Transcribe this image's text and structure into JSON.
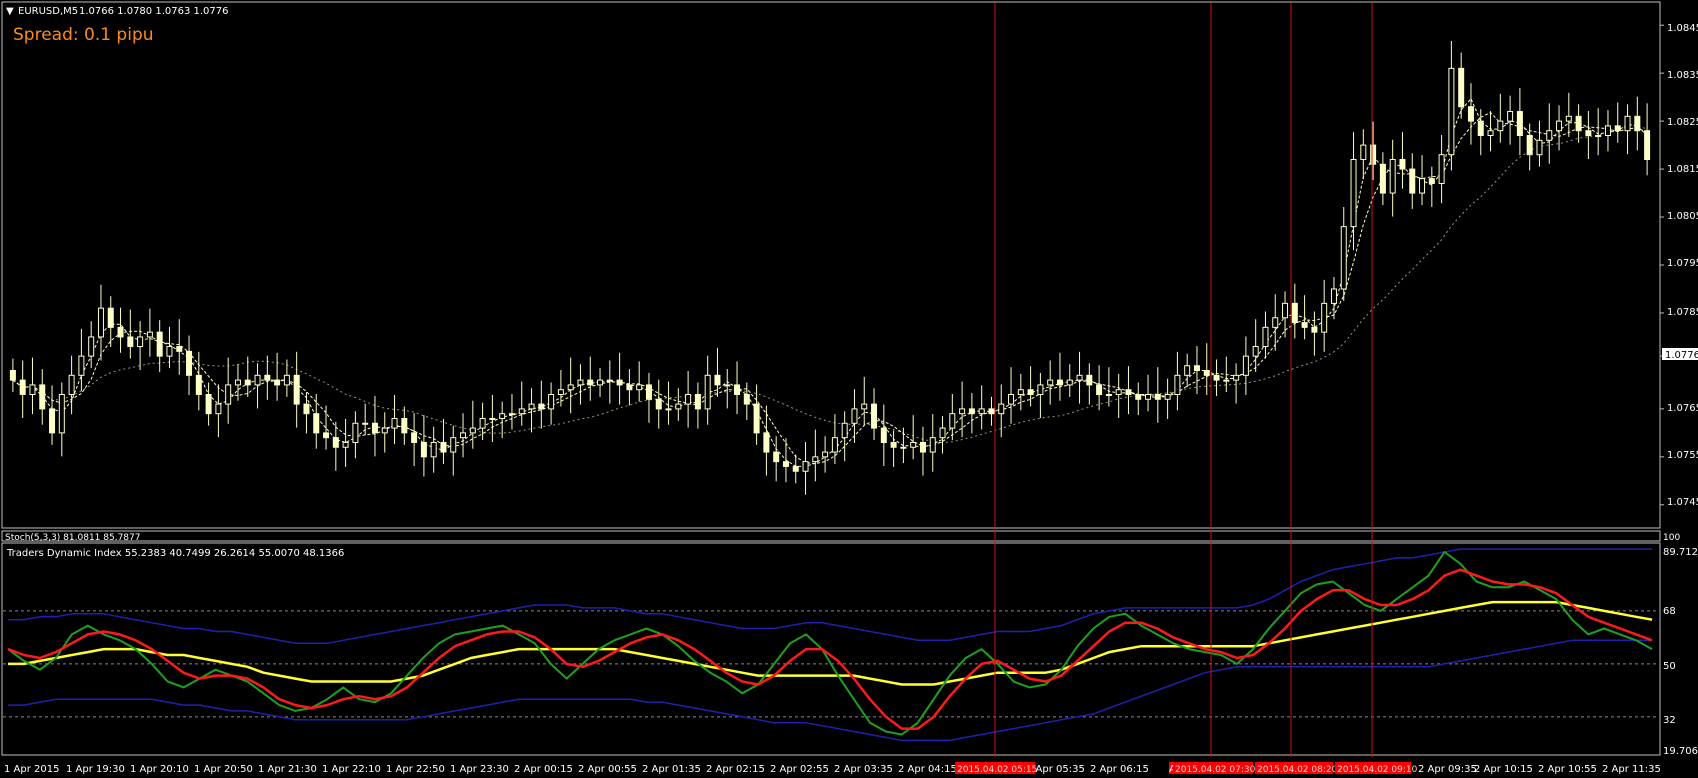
{
  "header": {
    "symbol": "EURUSD,M5",
    "ohlc": "1.0766 1.0780 1.0763 1.0776",
    "spread_text": "Spread: 0.1 pipu"
  },
  "colors": {
    "background": "#000000",
    "frame": "#c0c0c0",
    "candle": "#ffffc8",
    "ma": "#ffffc8",
    "vline": "#d01010",
    "tdi_green": "#1fa01f",
    "tdi_red": "#ff1a1a",
    "tdi_yellow": "#ffff33",
    "tdi_band": "#2020b0",
    "spread": "#ff8c1a",
    "time_badge": "#ff0000"
  },
  "price_axis": {
    "labels": [
      "1.0845",
      "1.0835",
      "1.0825",
      "1.0815",
      "1.0805",
      "1.0795",
      "1.0785",
      "1.0776",
      "1.0765",
      "1.0755",
      "1.0745"
    ],
    "current": "1.0776"
  },
  "stoch_panel": {
    "label": "Stoch(5,3,3) 81.0811 85.7877",
    "axis_value": "100"
  },
  "tdi_panel": {
    "label": "Traders Dynamic Index 55.2383 40.7499 26.2614 55.0070 48.1366",
    "axis_labels": [
      "89.7123",
      "68",
      "50",
      "32",
      "19.7063"
    ]
  },
  "time_axis": {
    "labels": [
      "1 Apr 2015",
      "1 Apr 19:30",
      "1 Apr 20:10",
      "1 Apr 20:50",
      "1 Apr 21:30",
      "1 Apr 22:10",
      "1 Apr 22:50",
      "1 Apr 23:30",
      "2 Apr 00:15",
      "2 Apr 00:55",
      "2 Apr 01:35",
      "2 Apr 02:15",
      "2 Apr 02:55",
      "2 Apr 03:35",
      "2 Apr 04:15",
      "2 Apr 05:35",
      "2 Apr 06:15",
      "2 Apr 09:35",
      "2 Apr 10:15",
      "2 Apr 10:55",
      "2 Apr 11:35"
    ],
    "badges": [
      "2015.04.02 05:15",
      "2015.04.02 07:30",
      "2015.04.02 08:20",
      "2015.04.02 09:10"
    ],
    "badge_prefix": "Ap"
  },
  "chart_data": {
    "type": "candlestick",
    "price_range": [
      1.0741,
      1.0849
    ],
    "closes": [
      1.0771,
      1.0768,
      1.077,
      1.0765,
      1.076,
      1.0768,
      1.0772,
      1.0776,
      1.078,
      1.0786,
      1.0782,
      1.078,
      1.0778,
      1.078,
      1.0781,
      1.0776,
      1.0778,
      1.0777,
      1.0772,
      1.0768,
      1.0764,
      1.0766,
      1.077,
      1.0771,
      1.077,
      1.0772,
      1.0771,
      1.077,
      1.0772,
      1.0766,
      1.0764,
      1.076,
      1.0759,
      1.0757,
      1.0758,
      1.0762,
      1.0762,
      1.076,
      1.0761,
      1.0763,
      1.076,
      1.0758,
      1.0755,
      1.0758,
      1.0756,
      1.0759,
      1.076,
      1.0761,
      1.0763,
      1.0763,
      1.0764,
      1.0764,
      1.0765,
      1.0766,
      1.0765,
      1.0768,
      1.0769,
      1.077,
      1.0771,
      1.077,
      1.0771,
      1.0771,
      1.077,
      1.0769,
      1.077,
      1.0767,
      1.0765,
      1.0765,
      1.0766,
      1.0768,
      1.0765,
      1.0772,
      1.077,
      1.077,
      1.0768,
      1.0766,
      1.076,
      1.0756,
      1.0754,
      1.0753,
      1.0752,
      1.0754,
      1.0755,
      1.0756,
      1.0759,
      1.0762,
      1.0765,
      1.0766,
      1.0761,
      1.0758,
      1.0757,
      1.0757,
      1.0758,
      1.0756,
      1.0759,
      1.0761,
      1.0764,
      1.0765,
      1.0764,
      1.0765,
      1.0764,
      1.0766,
      1.0768,
      1.0769,
      1.0768,
      1.077,
      1.0771,
      1.077,
      1.0771,
      1.0772,
      1.077,
      1.0768,
      1.0768,
      1.0769,
      1.0768,
      1.0767,
      1.0768,
      1.0767,
      1.0768,
      1.0772,
      1.0774,
      1.0773,
      1.0772,
      1.0771,
      1.0771,
      1.0772,
      1.0776,
      1.0778,
      1.0782,
      1.0784,
      1.0787,
      1.0783,
      1.0782,
      1.0781,
      1.0787,
      1.079,
      1.0803,
      1.0817,
      1.082,
      1.0816,
      1.081,
      1.0817,
      1.0815,
      1.081,
      1.0813,
      1.0812,
      1.0818,
      1.0836,
      1.0828,
      1.0825,
      1.0822,
      1.0823,
      1.0825,
      1.0827,
      1.0822,
      1.0818,
      1.0821,
      1.0823,
      1.0825,
      1.0826,
      1.0823,
      1.0822,
      1.0822,
      1.0824,
      1.0823,
      1.0826,
      1.0823,
      1.0817
    ],
    "opens": [
      1.0773,
      1.0771,
      1.0768,
      1.077,
      1.0765,
      1.076,
      1.0768,
      1.0772,
      1.0776,
      1.078,
      1.0786,
      1.0782,
      1.078,
      1.0778,
      1.078,
      1.0781,
      1.0776,
      1.0778,
      1.0777,
      1.0772,
      1.0768,
      1.0764,
      1.0766,
      1.077,
      1.0771,
      1.077,
      1.0772,
      1.0771,
      1.077,
      1.0772,
      1.0766,
      1.0764,
      1.076,
      1.0759,
      1.0757,
      1.0758,
      1.0762,
      1.0762,
      1.076,
      1.0761,
      1.0763,
      1.076,
      1.0758,
      1.0755,
      1.0758,
      1.0756,
      1.0759,
      1.076,
      1.0761,
      1.0763,
      1.0763,
      1.0764,
      1.0764,
      1.0765,
      1.0766,
      1.0765,
      1.0768,
      1.0769,
      1.077,
      1.0771,
      1.077,
      1.0771,
      1.0771,
      1.077,
      1.0769,
      1.077,
      1.0767,
      1.0765,
      1.0765,
      1.0766,
      1.0768,
      1.0765,
      1.0772,
      1.077,
      1.077,
      1.0768,
      1.0766,
      1.076,
      1.0756,
      1.0754,
      1.0753,
      1.0752,
      1.0754,
      1.0755,
      1.0756,
      1.0759,
      1.0762,
      1.0765,
      1.0766,
      1.0761,
      1.0758,
      1.0757,
      1.0757,
      1.0758,
      1.0756,
      1.0759,
      1.0761,
      1.0764,
      1.0765,
      1.0764,
      1.0765,
      1.0764,
      1.0766,
      1.0768,
      1.0769,
      1.0768,
      1.077,
      1.0771,
      1.077,
      1.0771,
      1.0772,
      1.077,
      1.0768,
      1.0768,
      1.0769,
      1.0768,
      1.0767,
      1.0768,
      1.0767,
      1.0768,
      1.0772,
      1.0774,
      1.0773,
      1.0772,
      1.0771,
      1.0771,
      1.0772,
      1.0776,
      1.0778,
      1.0782,
      1.0784,
      1.0787,
      1.0783,
      1.0782,
      1.0781,
      1.0787,
      1.079,
      1.0803,
      1.0817,
      1.082,
      1.0816,
      1.081,
      1.0817,
      1.0815,
      1.081,
      1.0813,
      1.0812,
      1.0818,
      1.0836,
      1.0828,
      1.0825,
      1.0822,
      1.0823,
      1.0825,
      1.0827,
      1.0822,
      1.0818,
      1.0821,
      1.0823,
      1.0825,
      1.0826,
      1.0823,
      1.0822,
      1.0822,
      1.0824,
      1.0823,
      1.0826,
      1.0823
    ],
    "tdi": {
      "range": [
        19.7063,
        89.7123
      ],
      "green": [
        55,
        51,
        48,
        52,
        60,
        63,
        60,
        58,
        55,
        50,
        44,
        42,
        45,
        48,
        46,
        44,
        40,
        36,
        34,
        35,
        38,
        42,
        38,
        37,
        40,
        46,
        52,
        57,
        60,
        61,
        62,
        63,
        60,
        57,
        50,
        45,
        50,
        55,
        58,
        60,
        62,
        60,
        56,
        51,
        47,
        44,
        40,
        43,
        50,
        57,
        60,
        55,
        46,
        38,
        30,
        27,
        26,
        30,
        38,
        46,
        52,
        55,
        50,
        44,
        42,
        43,
        48,
        56,
        62,
        66,
        67,
        63,
        60,
        57,
        55,
        54,
        53,
        50,
        55,
        62,
        68,
        74,
        77,
        78,
        74,
        70,
        68,
        72,
        76,
        80,
        88,
        84,
        78,
        76,
        76,
        78,
        75,
        72,
        65,
        60,
        62,
        60,
        58,
        55
      ],
      "red": [
        55,
        53,
        52,
        54,
        57,
        60,
        61,
        60,
        58,
        55,
        51,
        47,
        45,
        46,
        46,
        45,
        42,
        38,
        36,
        35,
        36,
        38,
        39,
        38,
        39,
        42,
        47,
        52,
        56,
        58,
        60,
        61,
        61,
        59,
        55,
        50,
        49,
        51,
        54,
        57,
        59,
        60,
        58,
        55,
        51,
        47,
        44,
        43,
        46,
        51,
        55,
        55,
        51,
        45,
        38,
        32,
        28,
        28,
        32,
        39,
        45,
        50,
        51,
        48,
        45,
        44,
        46,
        51,
        56,
        61,
        64,
        64,
        62,
        59,
        57,
        55,
        54,
        52,
        53,
        57,
        62,
        68,
        72,
        75,
        75,
        72,
        70,
        70,
        72,
        75,
        80,
        82,
        80,
        78,
        77,
        77,
        76,
        74,
        70,
        66,
        64,
        62,
        60,
        58
      ],
      "yellow": [
        50,
        50,
        51,
        52,
        53,
        54,
        55,
        55,
        55,
        54,
        53,
        53,
        52,
        51,
        50,
        49,
        47,
        46,
        45,
        44,
        44,
        44,
        44,
        44,
        44,
        45,
        46,
        48,
        50,
        52,
        53,
        54,
        55,
        55,
        55,
        55,
        55,
        55,
        55,
        54,
        53,
        52,
        51,
        50,
        49,
        48,
        47,
        46,
        46,
        46,
        46,
        46,
        46,
        46,
        45,
        44,
        43,
        43,
        43,
        44,
        45,
        46,
        47,
        47,
        47,
        47,
        48,
        50,
        52,
        54,
        55,
        56,
        56,
        56,
        56,
        56,
        56,
        56,
        56,
        57,
        58,
        59,
        60,
        61,
        62,
        63,
        64,
        65,
        66,
        67,
        68,
        69,
        70,
        71,
        71,
        71,
        71,
        71,
        70,
        69,
        68,
        67,
        66,
        65
      ],
      "upper_band": [
        65,
        65,
        66,
        66,
        67,
        67,
        67,
        66,
        65,
        64,
        63,
        62,
        62,
        61,
        61,
        60,
        59,
        58,
        57,
        57,
        57,
        58,
        59,
        60,
        61,
        62,
        63,
        64,
        65,
        66,
        67,
        68,
        69,
        70,
        70,
        70,
        69,
        69,
        69,
        68,
        67,
        67,
        66,
        65,
        64,
        63,
        62,
        62,
        62,
        63,
        64,
        64,
        63,
        62,
        61,
        60,
        59,
        58,
        58,
        58,
        59,
        60,
        61,
        61,
        61,
        62,
        63,
        65,
        67,
        68,
        69,
        69,
        69,
        69,
        69,
        69,
        69,
        69,
        70,
        72,
        75,
        78,
        80,
        82,
        83,
        84,
        85,
        86,
        86,
        87,
        88,
        89,
        89,
        89,
        89,
        89,
        89,
        89,
        89,
        89,
        89,
        89,
        89,
        89
      ],
      "lower_band": [
        36,
        36,
        37,
        38,
        38,
        38,
        38,
        38,
        38,
        38,
        37,
        36,
        36,
        35,
        34,
        34,
        33,
        32,
        31,
        31,
        31,
        31,
        31,
        31,
        31,
        31,
        32,
        33,
        34,
        35,
        36,
        37,
        38,
        38,
        38,
        38,
        38,
        38,
        38,
        38,
        37,
        37,
        36,
        35,
        34,
        33,
        32,
        31,
        30,
        30,
        30,
        29,
        28,
        27,
        26,
        25,
        24,
        24,
        24,
        24,
        25,
        26,
        27,
        28,
        29,
        30,
        31,
        32,
        33,
        35,
        37,
        39,
        41,
        43,
        45,
        47,
        48,
        49,
        49,
        49,
        49,
        49,
        49,
        49,
        49,
        49,
        49,
        49,
        49,
        49,
        50,
        51,
        52,
        53,
        54,
        55,
        56,
        57,
        58,
        58,
        58,
        58,
        58,
        58
      ]
    }
  }
}
